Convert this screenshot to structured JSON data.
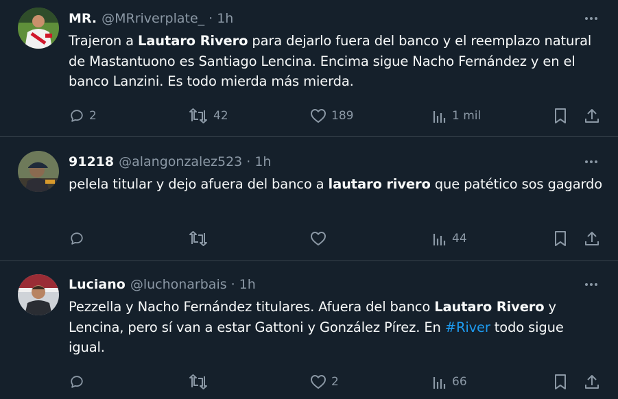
{
  "tweets": [
    {
      "name": "MR.",
      "handle": "@MRriverplate_",
      "separator": "·",
      "time": "1h",
      "text": [
        {
          "t": "Trajeron a "
        },
        {
          "t": "Lautaro Rivero",
          "bold": true
        },
        {
          "t": " para dejarlo fuera del banco y el reemplazo natural de Mastantuono es Santiago Lencina. Encima sigue Nacho Fernández y en el banco Lanzini. Es todo mierda más mierda."
        }
      ],
      "replies": "2",
      "retweets": "42",
      "likes": "189",
      "views": "1 mil"
    },
    {
      "name": "91218",
      "handle": "@alangonzalez523",
      "separator": "·",
      "time": "1h",
      "text": [
        {
          "t": "pelela titular y dejo afuera del banco a "
        },
        {
          "t": "lautaro rivero",
          "bold": true
        },
        {
          "t": " que patético sos gagardo"
        }
      ],
      "replies": "",
      "retweets": "",
      "likes": "",
      "views": "44"
    },
    {
      "name": "Luciano",
      "handle": "@luchonarbais",
      "separator": "·",
      "time": "1h",
      "text": [
        {
          "t": "Pezzella y Nacho Fernández titulares. Afuera del banco "
        },
        {
          "t": "Lautaro Rivero",
          "bold": true
        },
        {
          "t": " y Lencina, pero sí van a estar Gattoni y González Pírez. En "
        },
        {
          "t": "#River",
          "hashtag": true
        },
        {
          "t": " todo sigue igual."
        }
      ],
      "replies": "",
      "retweets": "",
      "likes": "2",
      "views": "66"
    }
  ],
  "icons": {
    "avatar_1": "player-in-white-kit-avatar",
    "avatar_2": "person-in-cap-avatar",
    "avatar_3": "person-in-stadium-avatar",
    "reply": "reply-icon",
    "retweet": "retweet-icon",
    "like": "heart-icon",
    "views": "views-bar-chart-icon",
    "bookmark": "bookmark-icon",
    "share": "share-icon",
    "more": "more-options-icon"
  },
  "colors": {
    "background": "#15202b",
    "divider": "#38444d",
    "text": "#f7f9f9",
    "secondary": "#8b98a5",
    "accent": "#1d9bf0"
  }
}
